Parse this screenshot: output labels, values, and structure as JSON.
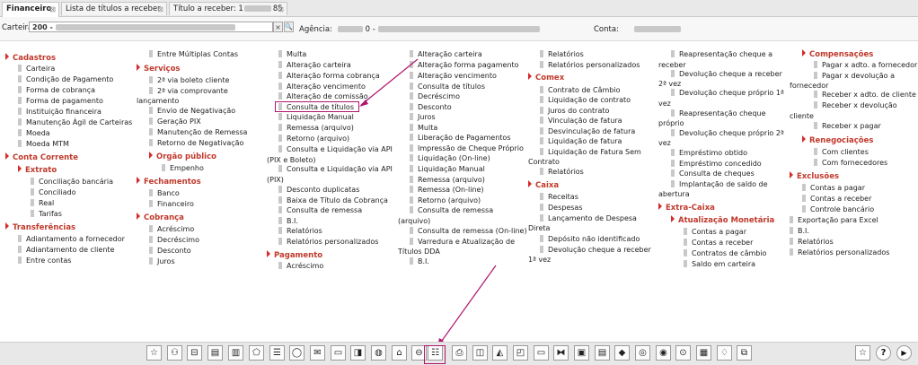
{
  "tabs": [
    {
      "label": "Financeiro"
    },
    {
      "label": "Lista de títulos a receber"
    },
    {
      "label": "Título a receber: 1"
    }
  ],
  "tab3_suffix": "85",
  "close_glyph": "⊠",
  "top": {
    "carteira_label": "Carteira:",
    "carteira_value": "200 -",
    "agencia_label": "Agência:",
    "agencia_sep": "0 -",
    "conta_label": "Conta:",
    "clear_glyph": "×",
    "search_glyph": "🔍"
  },
  "menu": {
    "col1": {
      "cadastros": "Cadastros",
      "cadastros_items": [
        "Carteira",
        "Condição de Pagamento",
        "Forma de cobrança",
        "Forma de pagamento",
        "Instituição financeira",
        "Manutenção Ágil de Carteiras",
        "Moeda",
        "Moeda MTM"
      ],
      "conta_corrente": "Conta Corrente",
      "extrato": "Extrato",
      "extrato_items": [
        "Conciliação bancária",
        "Conciliado",
        "Real",
        "Tarifas"
      ],
      "transferencias": "Transferências",
      "transferencias_items": [
        "Adiantamento a fornecedor",
        "Adiantamento de cliente",
        "Entre contas"
      ]
    },
    "col2": {
      "entre_multiplas": "Entre Múltiplas Contas",
      "servicos": "Serviços",
      "servicos_items": [
        "2ª via boleto cliente",
        "2ª via comprovante",
        "lançamento",
        "Envio de Negativação",
        "Geração PIX",
        "Manutenção de Remessa",
        "Retorno de Negativação"
      ],
      "orgao_publico": "Orgão público",
      "orgao_items": [
        "Empenho"
      ],
      "fechamentos": "Fechamentos",
      "fechamentos_items": [
        "Banco",
        "Financeiro"
      ],
      "cobranca": "Cobrança",
      "cobranca_items": [
        "Acréscimo",
        "Decréscimo",
        "Desconto",
        "Juros"
      ]
    },
    "col3": {
      "items": [
        "Multa",
        "Alteração carteira",
        "Alteração forma cobrança",
        "Alteração vencimento",
        "Alteração de comissão",
        "Consulta de títulos",
        "Liquidação Manual",
        "Remessa (arquivo)",
        "Retorno (arquivo)",
        "Consulta e Liquidação via API",
        "(PIX e Boleto)",
        "Consulta e Liquidação via API",
        "(PIX)",
        "Desconto duplicatas",
        "Baixa de Título da Cobrança",
        "Consulta de remessa",
        "B.I.",
        "Relatórios",
        "Relatórios personalizados"
      ],
      "pagamento": "Pagamento",
      "pagamento_items": [
        "Acréscimo"
      ]
    },
    "col4": {
      "items": [
        "Alteração carteira",
        "Alteração forma pagamento",
        "Alteração vencimento",
        "Consulta de títulos",
        "Decréscimo",
        "Desconto",
        "Juros",
        "Multa",
        "Liberação de Pagamentos",
        "Impressão de Cheque Próprio",
        "Liquidação (On-line)",
        "Liquidação Manual",
        "Remessa (arquivo)",
        "Remessa (On-line)",
        "Retorno (arquivo)",
        "Consulta de remessa",
        "(arquivo)",
        "Consulta de remessa (On-line)",
        "Varredura e Atualização de",
        "Títulos DDA",
        "B.I."
      ]
    },
    "col5": {
      "items_top": [
        "Relatórios",
        "Relatórios personalizados"
      ],
      "comex": "Comex",
      "comex_items": [
        "Contrato de Câmbio",
        "Liquidação de contrato",
        "Juros do contrato",
        "Vinculação de fatura",
        "Desvinculação de fatura",
        "Liquidação de fatura",
        "Liquidação de Fatura Sem",
        "Contrato",
        "Relatórios"
      ],
      "caixa": "Caixa",
      "caixa_items": [
        "Receitas",
        "Despesas",
        "Lançamento de Despesa",
        "Direta",
        "Depósito não identificado",
        "Devolução cheque a receber",
        "1ª vez"
      ]
    },
    "col6": {
      "items": [
        "Reapresentação cheque a",
        "receber",
        "Devolução cheque a receber",
        "2ª vez",
        "Devolução cheque próprio 1ª",
        "vez",
        "Reapresentação cheque",
        "próprio",
        "Devolução cheque próprio 2ª",
        "vez",
        "Empréstimo obtido",
        "Empréstimo concedido",
        "Consulta de cheques",
        "Implantação de saldo de",
        "abertura"
      ],
      "extra_caixa": "Extra-Caixa",
      "atualizacao": "Atualização Monetária",
      "atualizacao_items": [
        "Contas a pagar",
        "Contas a receber",
        "Contratos de câmbio",
        "Saldo em carteira"
      ]
    },
    "col7": {
      "compensacoes": "Compensações",
      "comp_items": [
        "Pagar x adto. a fornecedor",
        "Pagar x devolução a",
        "fornecedor",
        "Receber x adto. de cliente",
        "Receber x devolução",
        "cliente",
        "Receber x pagar"
      ],
      "renegociacoes": "Renegociações",
      "reneg_items": [
        "Com clientes",
        "Com fornecedores"
      ],
      "exclusoes": "Exclusões",
      "excl_items": [
        "Contas a pagar",
        "Contas a receber",
        "Controle bancário"
      ],
      "tail_items": [
        "Exportação para Excel",
        "B.I.",
        "Relatórios",
        "Relatórios personalizados"
      ]
    }
  },
  "toolbar": {
    "icons": [
      "☆",
      "⚇",
      "⊟",
      "▤",
      "▥",
      "⬠",
      "☰",
      "◯",
      "✉",
      "▭",
      "◨",
      "◍",
      "⌂",
      "⊖",
      "☷",
      "⎙",
      "◫",
      "◭",
      "◰",
      "▭",
      "⧓",
      "▣",
      "▤",
      "◆",
      "◎",
      "◉",
      "⊙",
      "▦",
      "♢",
      "⧉"
    ],
    "right_icons": [
      "☆",
      "?",
      "▶"
    ]
  }
}
